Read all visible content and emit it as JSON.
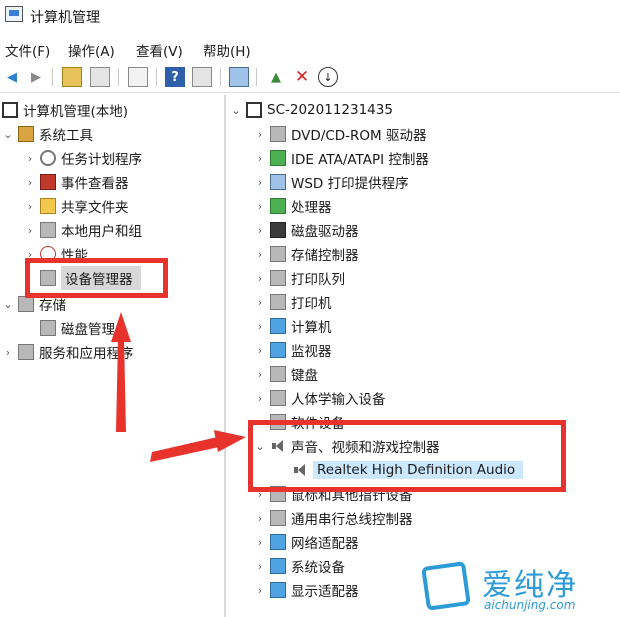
{
  "window": {
    "title": "计算机管理"
  },
  "menu": [
    "文件(F)",
    "操作(A)",
    "查看(V)",
    "帮助(H)"
  ],
  "toolbar": {
    "icons": [
      "back-arrow-icon",
      "forward-arrow-icon",
      "up-folder-icon",
      "show-hide-tree-icon",
      "properties-icon",
      "help-icon",
      "show-action-pane-icon",
      "scan-hardware-icon",
      "update-driver-icon",
      "uninstall-device-icon",
      "disable-device-icon"
    ]
  },
  "left_tree": {
    "root": "计算机管理(本地)",
    "system_tools": "系统工具",
    "task_scheduler": "任务计划程序",
    "event_viewer": "事件查看器",
    "shared_folders": "共享文件夹",
    "local_users": "本地用户和组",
    "performance": "性能",
    "device_manager": "设备管理器",
    "storage": "存储",
    "disk_management": "磁盘管理",
    "services": "服务和应用程序"
  },
  "right_tree": {
    "computer_name": "SC-202011231435",
    "categories": [
      "DVD/CD-ROM 驱动器",
      "IDE ATA/ATAPI 控制器",
      "WSD 打印提供程序",
      "处理器",
      "磁盘驱动器",
      "存储控制器",
      "打印队列",
      "打印机",
      "计算机",
      "监视器",
      "键盘",
      "人体学输入设备",
      "软件设备",
      "声音、视频和游戏控制器",
      "鼠标和其他指针设备",
      "通用串行总线控制器",
      "网络适配器",
      "系统设备",
      "显示适配器"
    ],
    "audio_device": "Realtek High Definition Audio"
  },
  "watermark": {
    "name": "爱纯净",
    "url": "aichunjing.com"
  },
  "colors": {
    "annotation_red": "#e8332d",
    "selection": "#cce8ff",
    "watermark_blue": "#2d9bd8"
  }
}
